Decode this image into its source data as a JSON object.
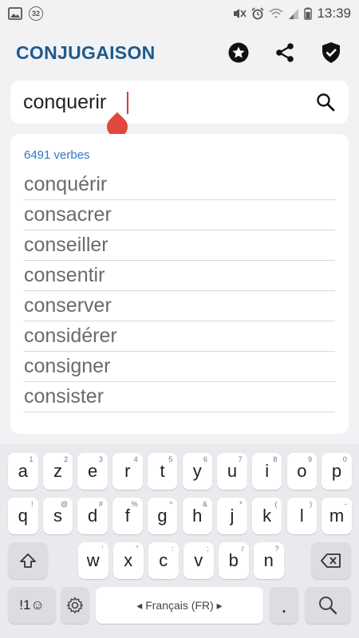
{
  "status": {
    "time": "13:39",
    "notif_count": "32"
  },
  "app": {
    "title": "CONJUGAISON",
    "icons": [
      "favorites-star-icon",
      "share-icon",
      "shield-check-icon"
    ]
  },
  "search": {
    "value": "conquerir",
    "icon": "search-icon"
  },
  "results": {
    "count": "6491 verbes",
    "verbs": [
      "conquérir",
      "consacrer",
      "conseiller",
      "consentir",
      "conserver",
      "considérer",
      "consigner",
      "consister"
    ]
  },
  "keyboard": {
    "row1": [
      {
        "k": "a",
        "h": "1"
      },
      {
        "k": "z",
        "h": "2"
      },
      {
        "k": "e",
        "h": "3"
      },
      {
        "k": "r",
        "h": "4"
      },
      {
        "k": "t",
        "h": "5"
      },
      {
        "k": "y",
        "h": "6"
      },
      {
        "k": "u",
        "h": "7"
      },
      {
        "k": "i",
        "h": "8"
      },
      {
        "k": "o",
        "h": "9"
      },
      {
        "k": "p",
        "h": "0"
      }
    ],
    "row2": [
      {
        "k": "q",
        "h": "!"
      },
      {
        "k": "s",
        "h": "@"
      },
      {
        "k": "d",
        "h": "#"
      },
      {
        "k": "f",
        "h": "%"
      },
      {
        "k": "g",
        "h": "^"
      },
      {
        "k": "h",
        "h": "&"
      },
      {
        "k": "j",
        "h": "*"
      },
      {
        "k": "k",
        "h": "("
      },
      {
        "k": "l",
        "h": ")"
      },
      {
        "k": "m",
        "h": "-"
      }
    ],
    "row3": [
      {
        "k": "w",
        "h": "'"
      },
      {
        "k": "x",
        "h": "\""
      },
      {
        "k": "c",
        "h": ":"
      },
      {
        "k": "v",
        "h": ";"
      },
      {
        "k": "b",
        "h": "/"
      },
      {
        "k": "n",
        "h": "?"
      }
    ],
    "symbols_label": "!1☺",
    "space_label": "◂  Français (FR)  ▸",
    "period_label": ".",
    "accent_color": "#1e5a8c",
    "link_color": "#2f78c4"
  }
}
